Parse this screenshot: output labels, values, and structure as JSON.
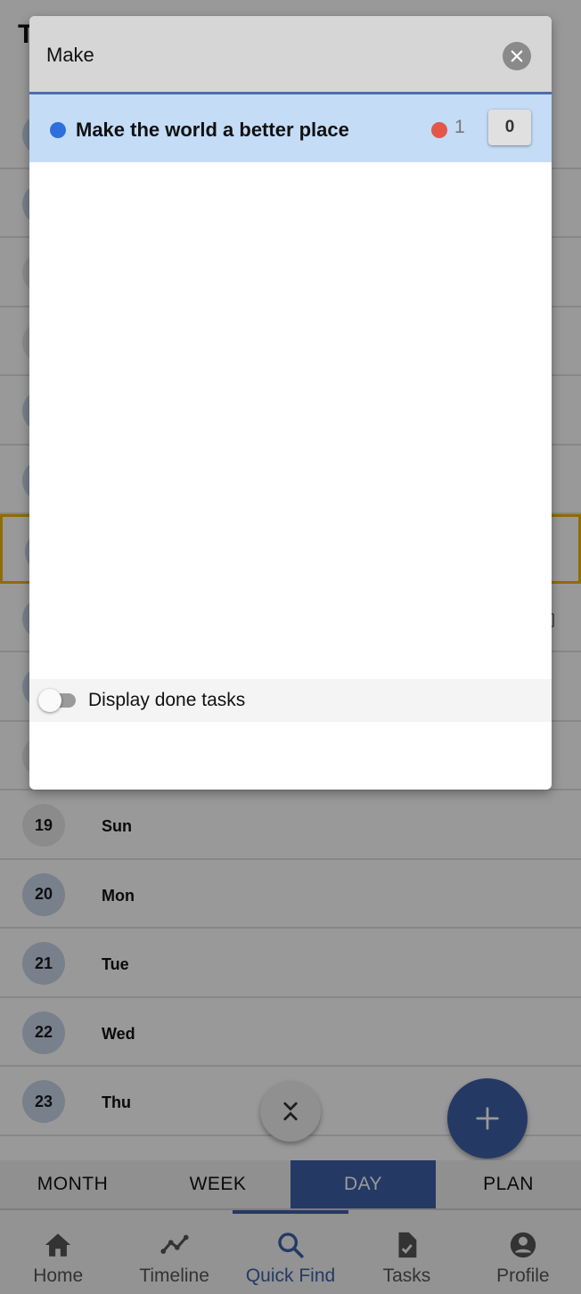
{
  "page": {
    "title": "T"
  },
  "days": [
    {
      "number": "",
      "name": "",
      "weekend": false
    },
    {
      "number": "",
      "name": "",
      "weekend": false
    },
    {
      "number": "",
      "name": "",
      "weekend": true
    },
    {
      "number": "",
      "name": "",
      "weekend": true
    },
    {
      "number": "",
      "name": "",
      "weekend": false
    },
    {
      "number": "",
      "name": "",
      "weekend": false
    },
    {
      "number": "",
      "name": "",
      "weekend": false,
      "today": true
    },
    {
      "number": "",
      "name": "",
      "weekend": false,
      "mark": true
    },
    {
      "number": "",
      "name": "",
      "weekend": false
    },
    {
      "number": "",
      "name": "",
      "weekend": true
    },
    {
      "number": "19",
      "name": "Sun",
      "weekend": true
    },
    {
      "number": "20",
      "name": "Mon",
      "weekend": false
    },
    {
      "number": "21",
      "name": "Tue",
      "weekend": false
    },
    {
      "number": "22",
      "name": "Wed",
      "weekend": false
    },
    {
      "number": "23",
      "name": "Thu",
      "weekend": false
    }
  ],
  "view_tabs": [
    {
      "label": "MONTH",
      "active": false
    },
    {
      "label": "WEEK",
      "active": false
    },
    {
      "label": "DAY",
      "active": true
    },
    {
      "label": "PLAN",
      "active": false
    }
  ],
  "bottom_nav": [
    {
      "label": "Home",
      "icon": "home-icon",
      "active": false
    },
    {
      "label": "Timeline",
      "icon": "timeline-icon",
      "active": false
    },
    {
      "label": "Quick Find",
      "icon": "search-icon",
      "active": true
    },
    {
      "label": "Tasks",
      "icon": "task-document-icon",
      "active": false
    },
    {
      "label": "Profile",
      "icon": "account-icon",
      "active": false
    }
  ],
  "quick_find": {
    "search_value": "Make",
    "results": [
      {
        "title": "Make the world a better place",
        "priority_count": "1",
        "count": "0",
        "dot_color": "#2f6fdc",
        "priority_color": "#e2574a"
      }
    ],
    "display_done_label": "Display done tasks",
    "display_done_on": false
  },
  "colors": {
    "accent": "#3f5fa8",
    "result_highlight": "#c4dcf5",
    "today_border": "#f2b400"
  }
}
